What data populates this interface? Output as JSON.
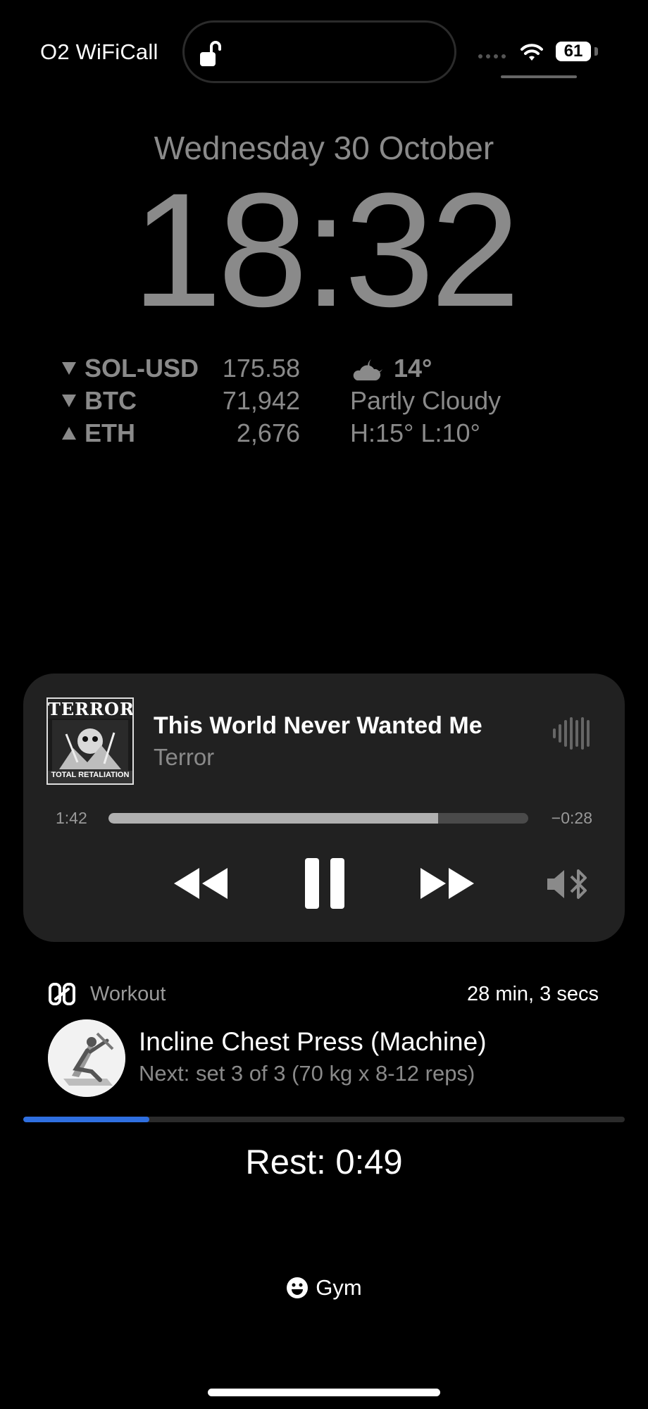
{
  "status_bar": {
    "carrier": "O2 WiFiCall",
    "battery": "61",
    "icons": [
      "lock-open-icon",
      "cellular-signal-icon",
      "wifi-icon",
      "battery-icon"
    ]
  },
  "lockscreen": {
    "date": "Wednesday 30 October",
    "time": "18:32"
  },
  "stocks": [
    {
      "direction": "down",
      "symbol": "SOL-USD",
      "value": "175.58"
    },
    {
      "direction": "down",
      "symbol": "BTC",
      "value": "71,942"
    },
    {
      "direction": "up",
      "symbol": "ETH",
      "value": "2,676"
    }
  ],
  "weather": {
    "icon": "partly-cloudy-night-icon",
    "temp": "14°",
    "condition": "Partly Cloudy",
    "high_low": "H:15° L:10°"
  },
  "now_playing": {
    "artwork": {
      "band": "TERROR",
      "album": "TOTAL RETALIATION"
    },
    "title": "This World Never Wanted Me",
    "artist": "Terror",
    "elapsed": "1:42",
    "remaining": "−0:28",
    "progress": 0.785,
    "controls": [
      "rewind-icon",
      "pause-icon",
      "fast-forward-icon",
      "bluetooth-speaker-icon"
    ]
  },
  "workout": {
    "label": "Workout",
    "duration": "28 min, 3 secs",
    "exercise": "Incline Chest Press (Machine)",
    "next": "Next: set 3 of 3 (70 kg x 8-12 reps)",
    "rest_label": "Rest:",
    "rest_time": "0:49",
    "rest_progress": 0.21,
    "accent": "#2f6fe0"
  },
  "focus": {
    "icon": "smiley-face-icon",
    "label": "Gym"
  }
}
